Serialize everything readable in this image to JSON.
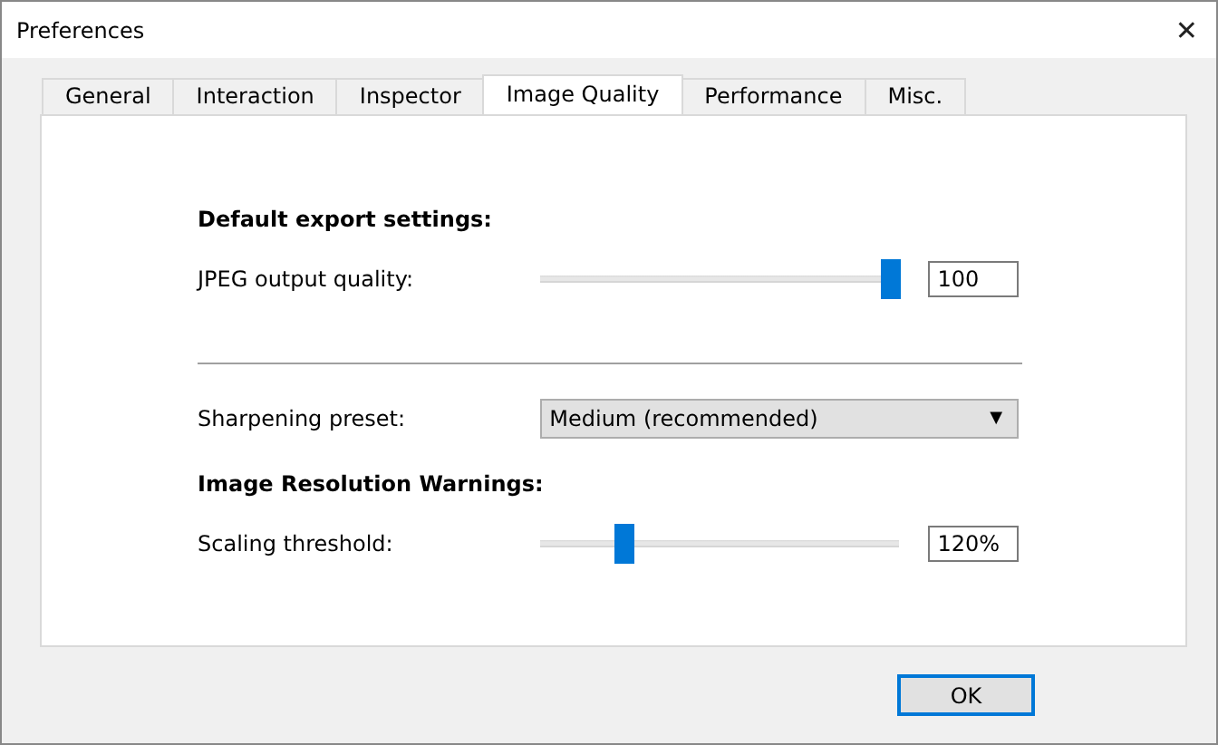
{
  "window": {
    "title": "Preferences",
    "close": "✕"
  },
  "tabs": [
    {
      "label": "General",
      "selected": false
    },
    {
      "label": "Interaction",
      "selected": false
    },
    {
      "label": "Inspector",
      "selected": false
    },
    {
      "label": "Image Quality",
      "selected": true
    },
    {
      "label": "Performance",
      "selected": false
    },
    {
      "label": "Misc.",
      "selected": false
    }
  ],
  "sections": [
    {
      "heading": "Default export settings:",
      "rows": [
        {
          "kind": "slider",
          "label": "JPEG output quality:",
          "level": 1,
          "value": "100"
        }
      ]
    },
    {
      "divider": true,
      "rows": [
        {
          "kind": "dropdown",
          "label": "Sharpening preset:",
          "value": "Medium (recommended)",
          "caret": "▼"
        }
      ]
    },
    {
      "heading": "Image Resolution Warnings:",
      "rows": [
        {
          "kind": "slider",
          "label": "Scaling threshold:",
          "level": 0.22,
          "value": "120%"
        }
      ]
    }
  ],
  "buttons": [
    "OK"
  ]
}
